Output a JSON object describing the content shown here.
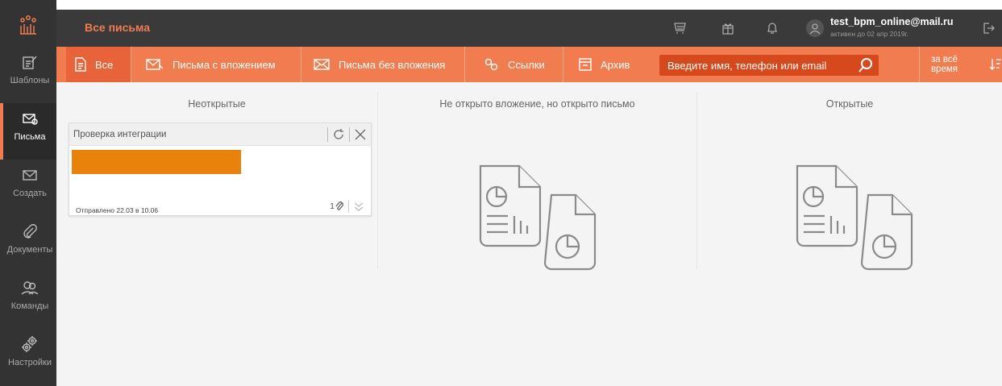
{
  "app": {
    "title": "Все письма"
  },
  "topbar_icons": [
    "cart-icon",
    "gift-icon",
    "bell-icon",
    "user-icon",
    "logout-icon"
  ],
  "user": {
    "email": "test_bpm_online@mail.ru",
    "status": "активен до 02 апр 2019г."
  },
  "sidebar": {
    "items": [
      {
        "label": "Шаблоны",
        "icon": "template-edit-icon"
      },
      {
        "label": "Письма",
        "icon": "mail-sent-icon",
        "active": true
      },
      {
        "label": "Создать",
        "icon": "envelope-icon"
      },
      {
        "label": "Документы",
        "icon": "paperclip-icon"
      },
      {
        "label": "Команды",
        "icon": "team-icon"
      },
      {
        "label": "Настройки",
        "icon": "settings-gears-icon"
      }
    ]
  },
  "tabs": [
    {
      "label": "Все",
      "icon": "document-icon",
      "active": true
    },
    {
      "label": "Письма с вложением",
      "icon": "mail-attachment-icon"
    },
    {
      "label": "Письма без вложения",
      "icon": "envelope-icon"
    },
    {
      "label": "Ссылки",
      "icon": "link-icon"
    },
    {
      "label": "Архив",
      "icon": "archive-icon"
    }
  ],
  "search": {
    "placeholder": "Введите имя, телефон или email"
  },
  "period": {
    "label": "за всё время"
  },
  "columns": [
    {
      "title": "Неоткрытые"
    },
    {
      "title": "Не открыто вложение, но открыто письмо"
    },
    {
      "title": "Открытые"
    }
  ],
  "card": {
    "title": "Проверка интеграции",
    "sent": "Отправлено 22.03 в 10.06",
    "attachments_count": "1",
    "bar_color": "#e8820a"
  },
  "colors": {
    "accent": "#f07c50",
    "accent_dark": "#e8633a",
    "sidebar": "#333333",
    "topbar": "#3a3a3a"
  }
}
